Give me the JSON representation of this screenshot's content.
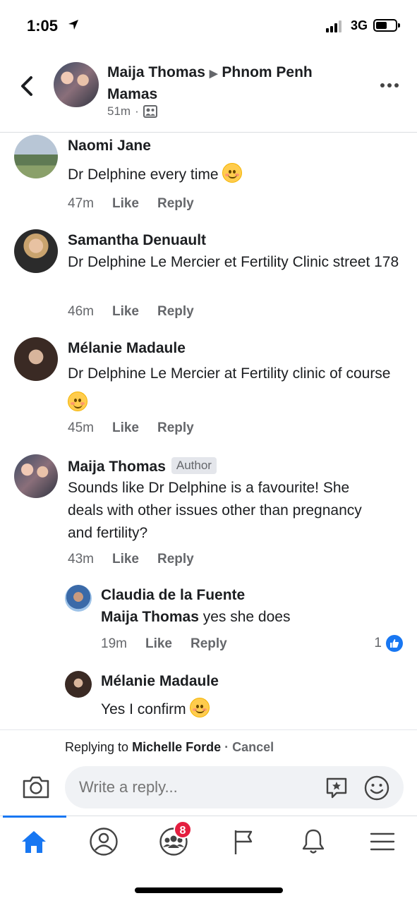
{
  "status_bar": {
    "time": "1:05",
    "network": "3G"
  },
  "header": {
    "author": "Maija Thomas",
    "group": "Phnom Penh Mamas",
    "time_ago": "51m",
    "separator": "·"
  },
  "comments": [
    {
      "name": "Naomi Jane",
      "text": "Dr Delphine every time",
      "emoji": "smiling-face-icon",
      "time": "47m",
      "like": "Like",
      "reply": "Reply"
    },
    {
      "name": "Samantha Denuault",
      "text": "Dr Delphine Le Mercier et Fertility Clinic street 178",
      "time": "46m",
      "like": "Like",
      "reply": "Reply"
    },
    {
      "name": "Mélanie Madaule",
      "text": "Dr Delphine Le Mercier at Fertility clinic of course",
      "emoji": "smiling-face-with-smiling-eyes-icon",
      "time": "45m",
      "like": "Like",
      "reply": "Reply"
    },
    {
      "name": "Maija Thomas",
      "badge": "Author",
      "text": "Sounds like Dr Delphine is a favourite! She deals with other issues other than pregnancy and fertility?",
      "time": "43m",
      "like": "Like",
      "reply": "Reply"
    }
  ],
  "replies": [
    {
      "name": "Claudia de la Fuente",
      "mention": "Maija Thomas",
      "text": " yes she does",
      "time": "19m",
      "like": "Like",
      "reply": "Reply",
      "like_count": "1"
    },
    {
      "name": "Mélanie Madaule",
      "text": "Yes I confirm",
      "emoji": "winking-face-icon"
    }
  ],
  "composer": {
    "replying_prefix": "Replying to",
    "replying_to": "Michelle Forde",
    "cancel": "· Cancel",
    "placeholder": "Write a reply..."
  },
  "tabbar": {
    "active": "home",
    "groups_badge": "8",
    "accent": "#1877f2"
  }
}
